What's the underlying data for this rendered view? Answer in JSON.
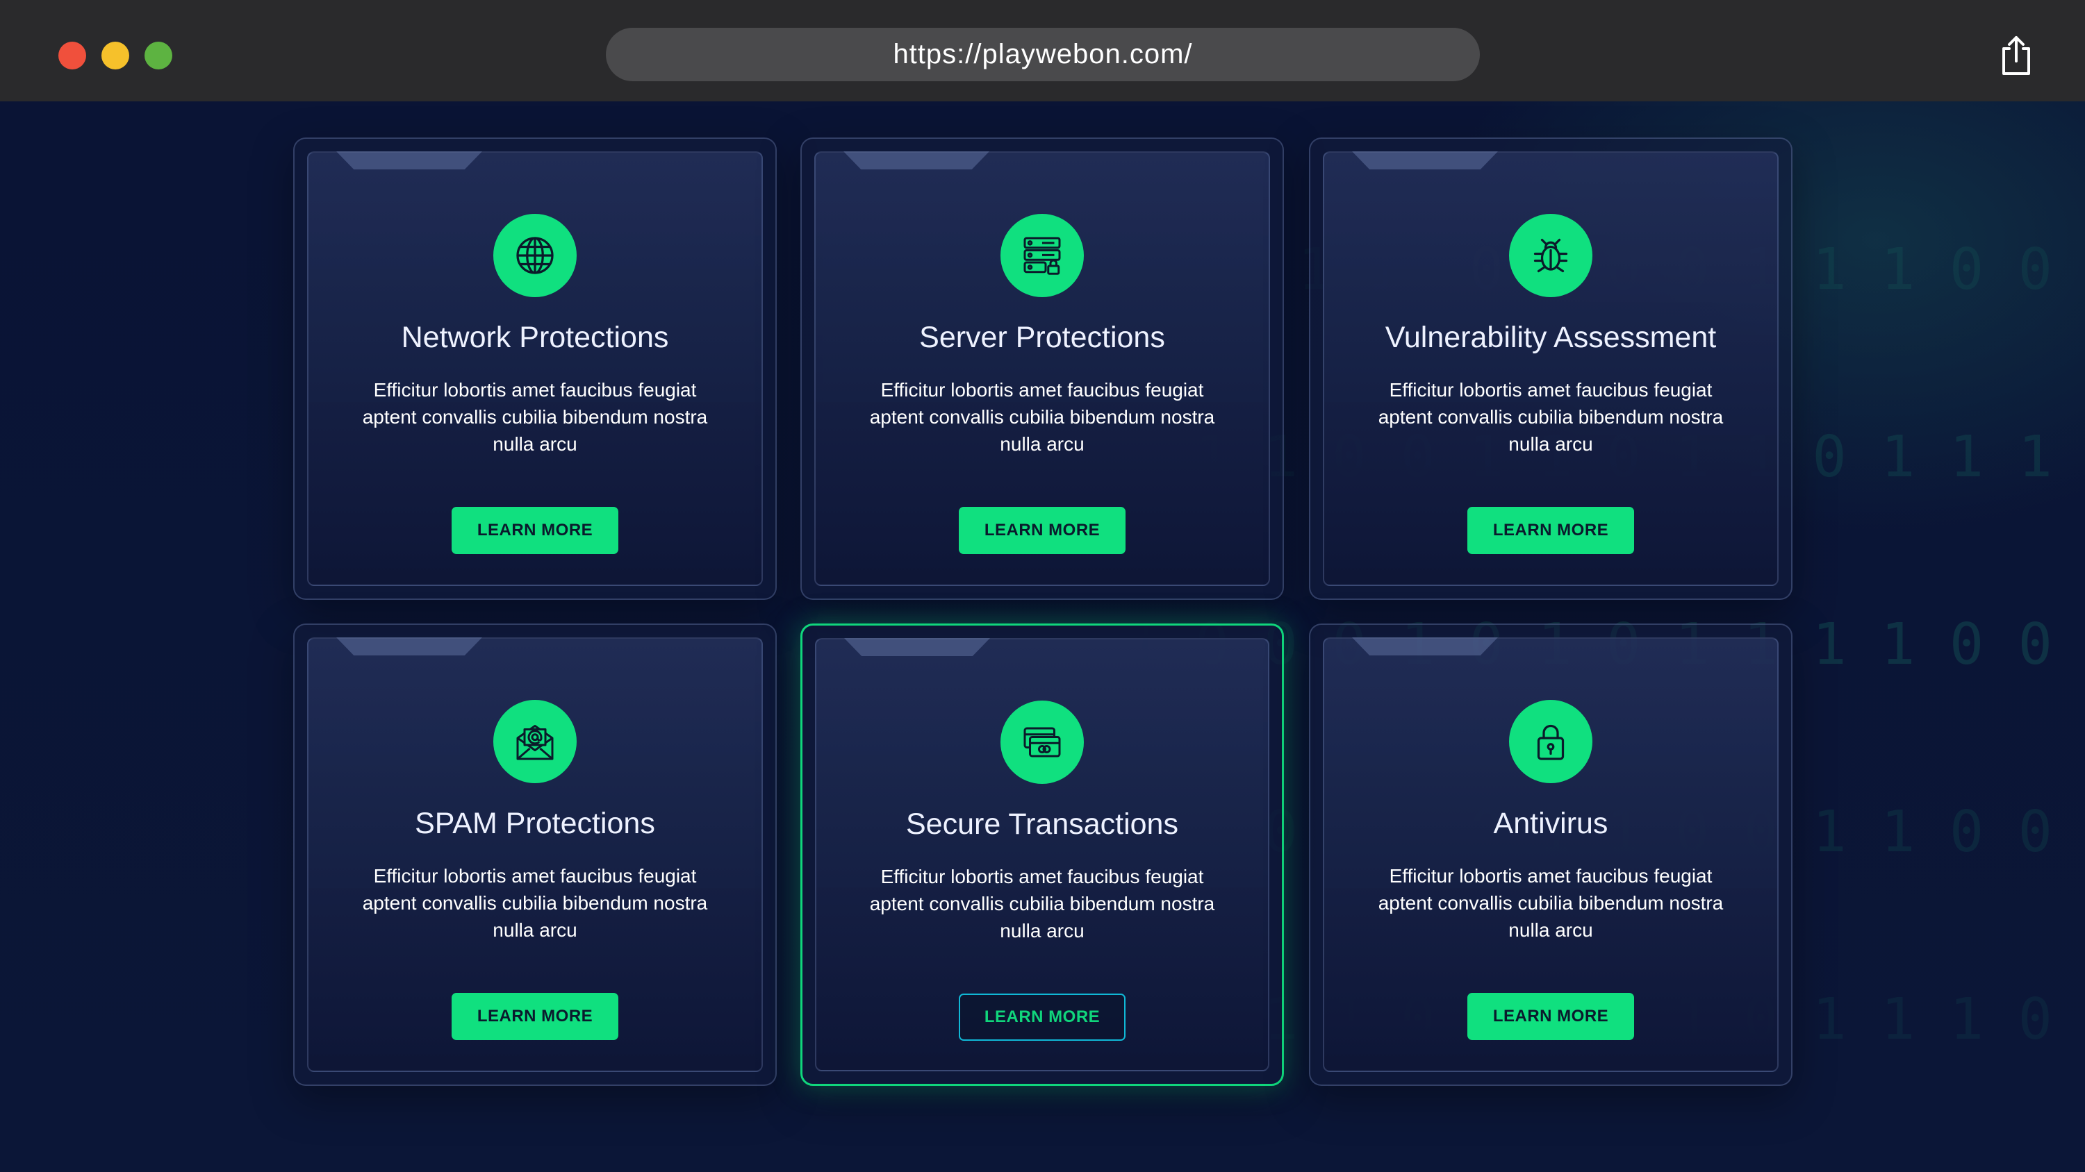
{
  "browser": {
    "url": "https://playwebon.com/"
  },
  "background": {
    "binary_rows": [
      "1  0 1 1  0 0 0 0 1 1 1 0 0 1 1 0 1 1  1 1 1 0 1 1 0 1 1 0",
      "0 1 1 0 0 1 1 0 1 1 0 1 1 1 0 0 1 1 0 0 1 0 1 0 0 0 1 1",
      "1 0 0 0 1 0 1 0 1 1 1 1 0 0 0 0 1 1 1 0 1 0 0",
      "1 1 0 1 1 0 1 1 0 0 1 1 0 0 1 1 0 0 1 1",
      "1 0 1 1 0 0 1 0 1 0 1 1 1 0 0 1"
    ]
  },
  "colors": {
    "accent": "#10e07f",
    "outline_button_border": "#10b8d6",
    "background": "#0a1435"
  },
  "cards": [
    {
      "icon": "globe-icon",
      "title": "Network Protections",
      "description": "Efficitur lobortis amet faucibus feugiat aptent convallis cubilia bibendum nostra nulla arcu",
      "button": "LEARN MORE"
    },
    {
      "icon": "server-lock-icon",
      "title": "Server Protections",
      "description": "Efficitur lobortis amet faucibus feugiat aptent convallis cubilia bibendum nostra nulla arcu",
      "button": "LEARN MORE"
    },
    {
      "icon": "bug-icon",
      "title": "Vulnerability Assessment",
      "description": "Efficitur lobortis amet faucibus feugiat aptent convallis cubilia bibendum nostra nulla arcu",
      "button": "LEARN MORE"
    },
    {
      "icon": "envelope-icon",
      "title": "SPAM Protections",
      "description": "Efficitur lobortis amet faucibus feugiat aptent convallis cubilia bibendum nostra nulla arcu",
      "button": "LEARN MORE"
    },
    {
      "icon": "credit-card-icon",
      "title": "Secure Transactions",
      "description": "Efficitur lobortis amet faucibus feugiat aptent convallis cubilia bibendum nostra nulla arcu",
      "button": "LEARN MORE",
      "active": true
    },
    {
      "icon": "padlock-icon",
      "title": "Antivirus",
      "description": "Efficitur lobortis amet faucibus feugiat aptent convallis cubilia bibendum nostra nulla arcu",
      "button": "LEARN MORE"
    }
  ]
}
